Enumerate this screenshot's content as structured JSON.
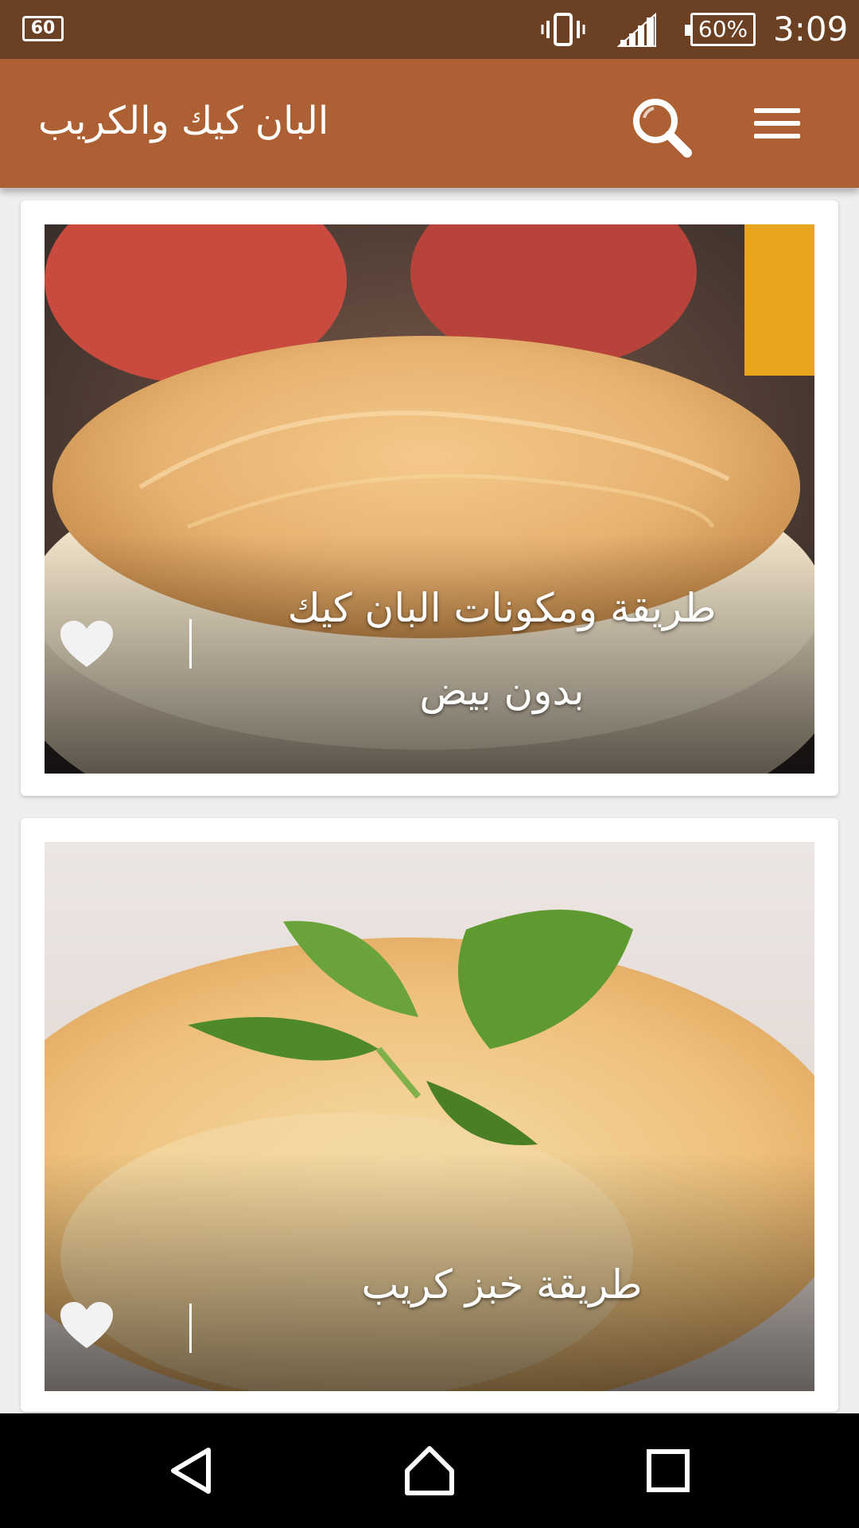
{
  "status_bar": {
    "left_badge": "60",
    "battery": "60%",
    "time": "3:09",
    "icons": [
      "vibrate-icon",
      "cell-signal-icon",
      "battery-icon"
    ]
  },
  "app_bar": {
    "title": "البان كيك والكريب",
    "icons": [
      "search-icon",
      "menu-icon"
    ],
    "color": "#ad6033"
  },
  "recipes": [
    {
      "title_line1": "طريقة ومكونات البان كيك",
      "title_line2": "بدون بيض",
      "favorite_icon": "heart-icon"
    },
    {
      "title_line1": "طريقة خبز كريب",
      "favorite_icon": "heart-icon"
    }
  ],
  "nav_bar": {
    "icons": [
      "back-icon",
      "home-icon",
      "recent-apps-icon"
    ]
  }
}
